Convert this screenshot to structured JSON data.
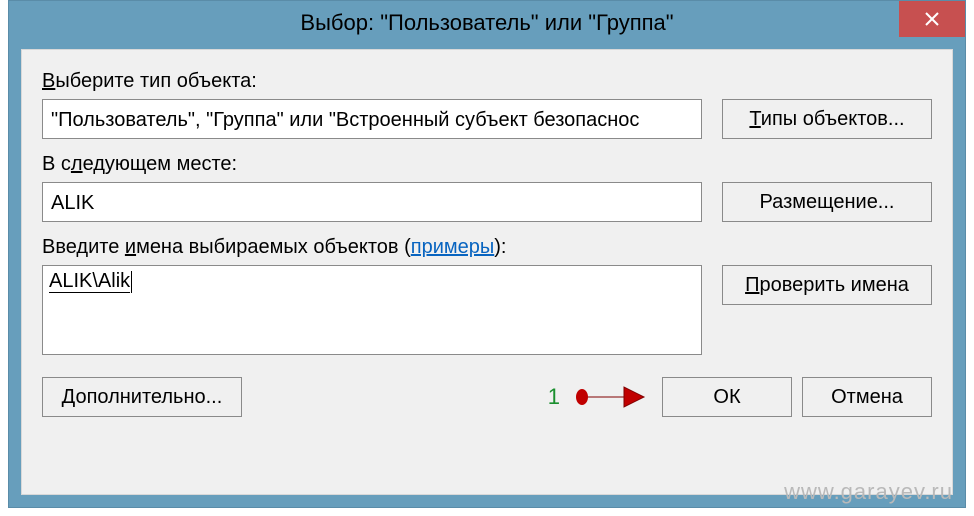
{
  "titlebar": {
    "title": "Выбор: \"Пользователь\" или \"Группа\""
  },
  "labels": {
    "object_type_pre": "",
    "object_type_u": "В",
    "object_type_post": "ыберите тип объекта:",
    "location_pre": "В с",
    "location_u": "л",
    "location_post": "едующем месте:",
    "names_pre": "Введите ",
    "names_u": "и",
    "names_post": "мена выбираемых объектов (",
    "examples_link": "примеры",
    "names_tail": "):"
  },
  "fields": {
    "object_type_value": "\"Пользователь\", \"Группа\" или \"Встроенный субъект безопаснос",
    "location_value": "ALIK",
    "names_value": "ALIK\\Alik"
  },
  "buttons": {
    "object_types_u": "Т",
    "object_types_post": "ипы объектов...",
    "locations": "Размещение...",
    "check_names_u": "П",
    "check_names_post": "роверить имена",
    "advanced_u": "Д",
    "advanced_post": "ополнительно...",
    "ok": "ОК",
    "cancel": "Отмена"
  },
  "annotation": {
    "number": "1"
  },
  "watermark": "www.garayev.ru"
}
